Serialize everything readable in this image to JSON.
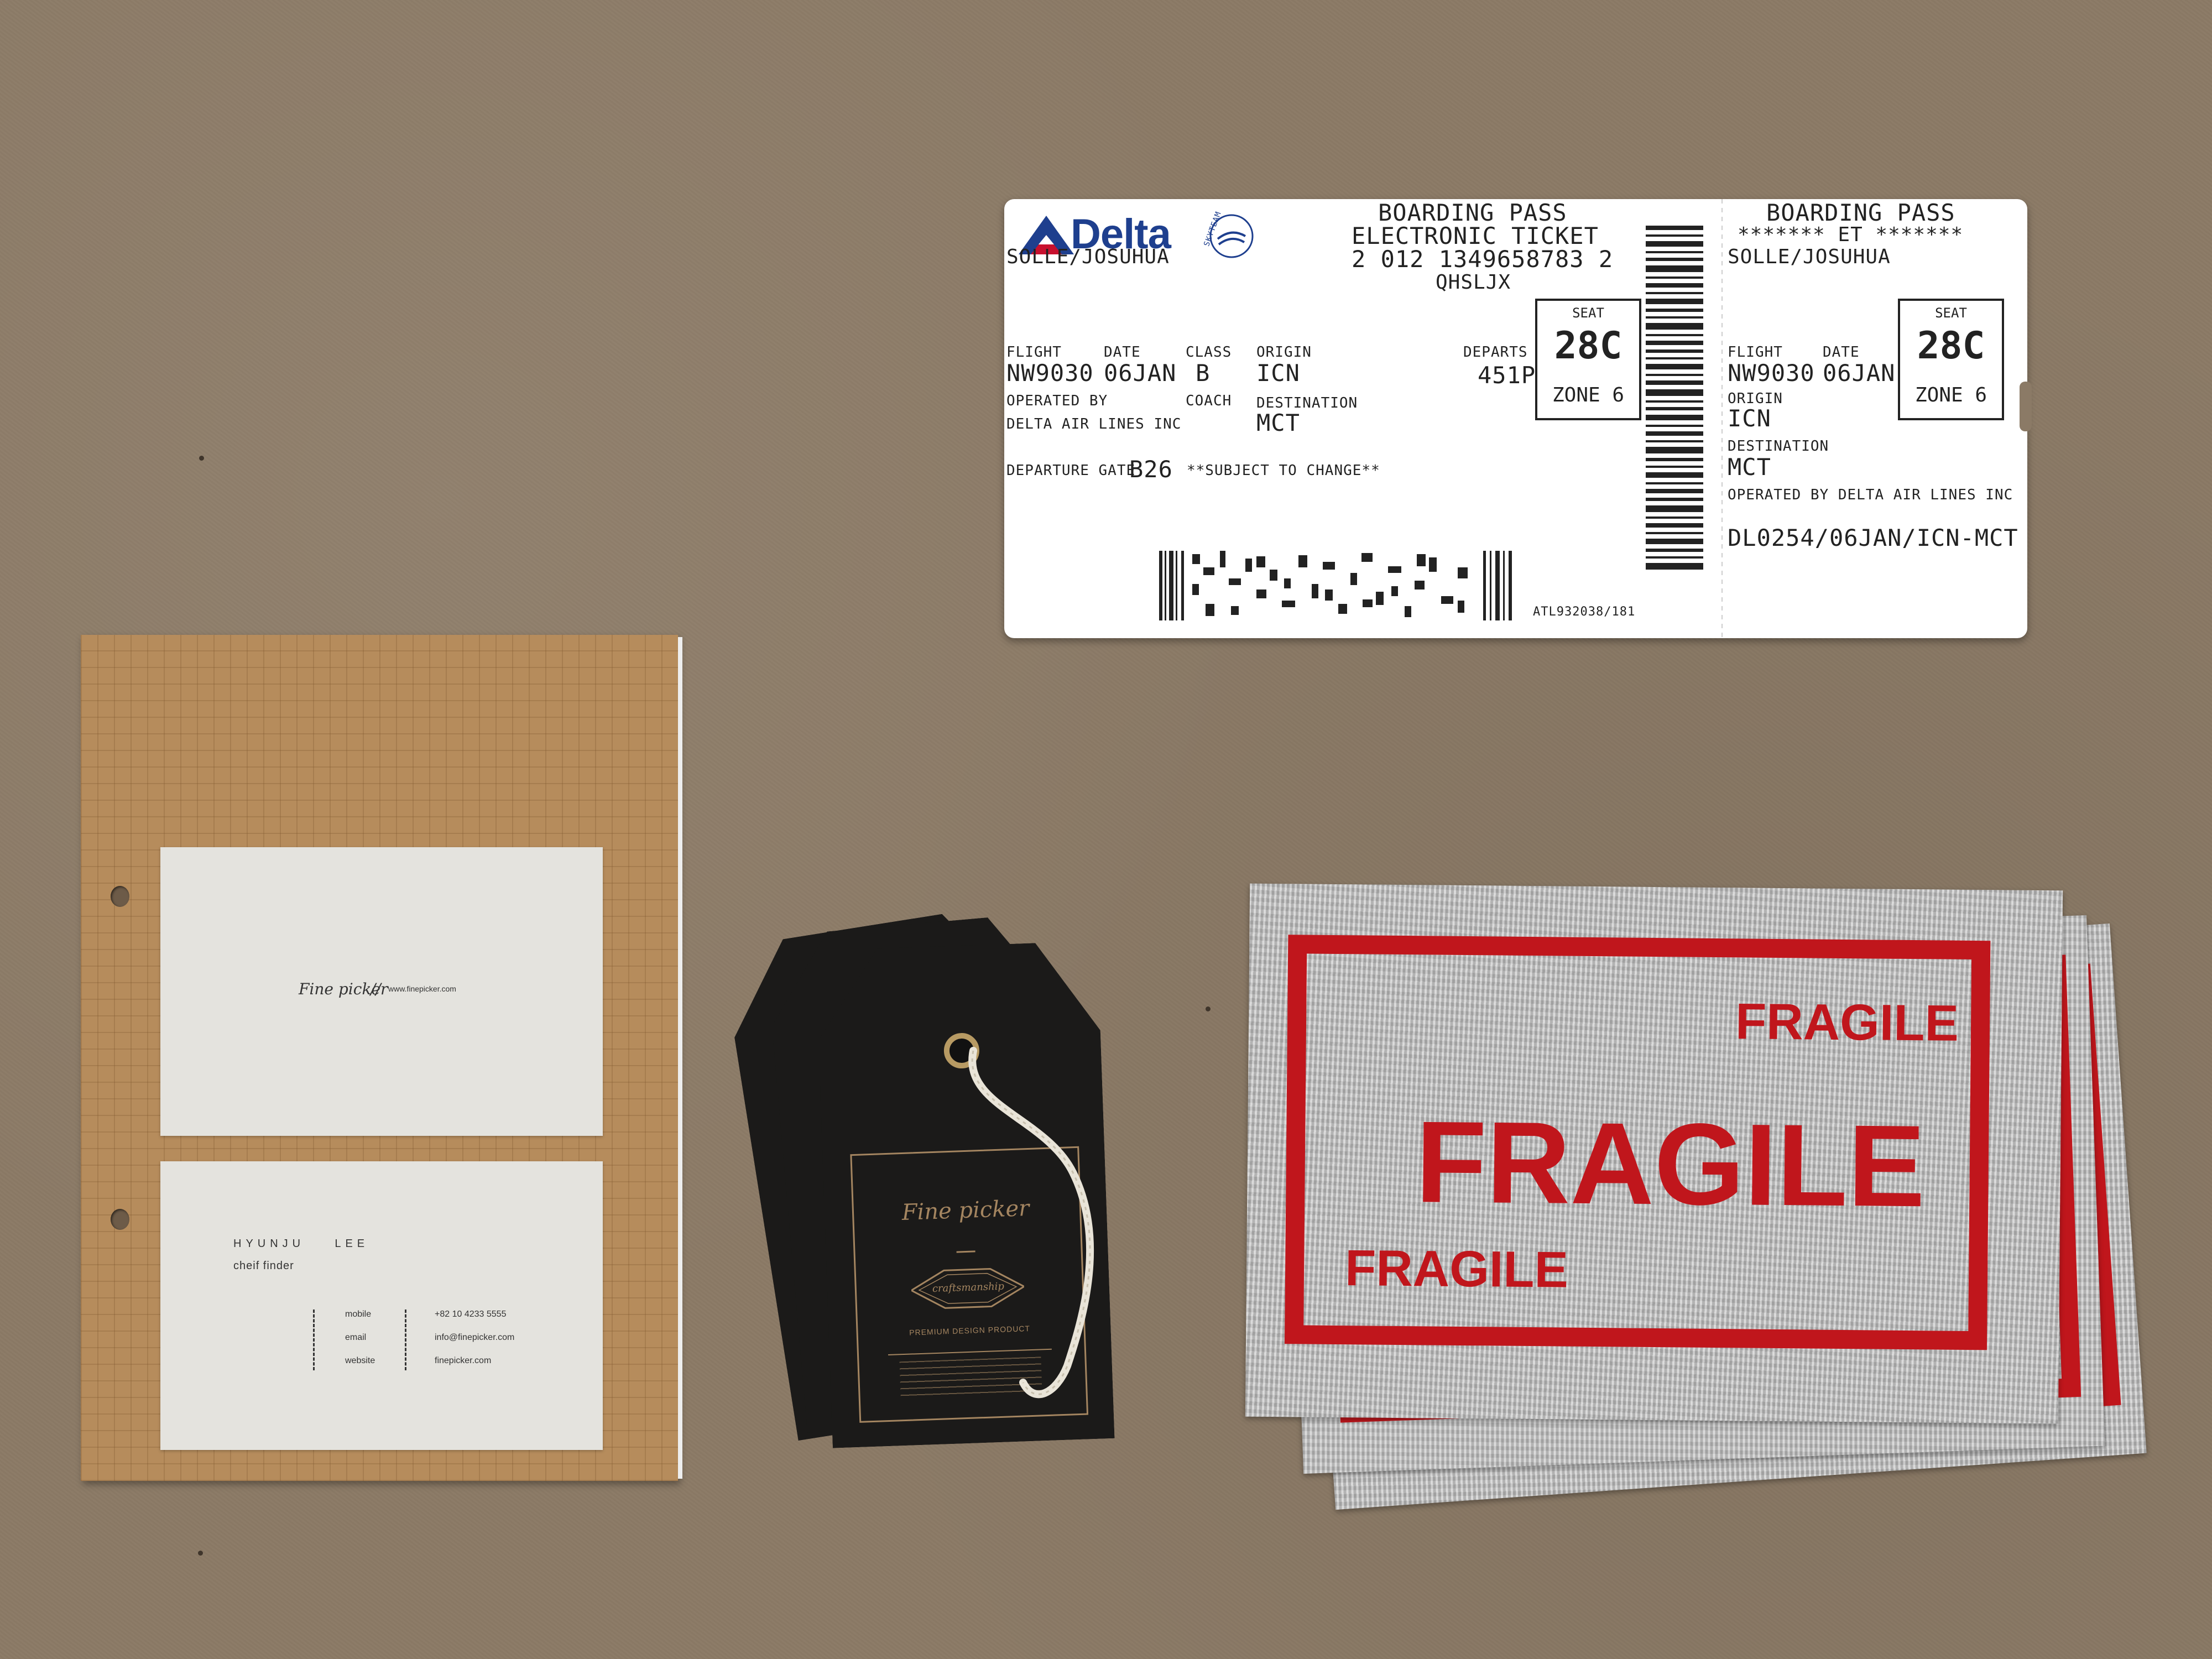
{
  "colors": {
    "background": "#8b7a66",
    "fragile_red": "#c0161c",
    "delta_blue": "#1e3f8e",
    "tag_gold": "#a48560"
  },
  "boarding_pass": {
    "logo": "Delta",
    "skyteam": "SKYTEAM",
    "heading": "BOARDING PASS",
    "electronic_ticket": "ELECTRONIC TICKET",
    "ticket_number": "2 012 1349658783 2",
    "record_locator": "QHSLJX",
    "passenger": "SOLLE/JOSUHUA",
    "flight_label": "FLIGHT",
    "flight": "NW9030",
    "date_label": "DATE",
    "date": "06JAN",
    "class_label": "CLASS",
    "class": "B",
    "coach": "COACH",
    "origin_label": "ORIGIN",
    "origin": "ICN",
    "destination_label": "DESTINATION",
    "destination": "MCT",
    "operated_by_label": "OPERATED BY",
    "operated_by": "DELTA AIR LINES INC",
    "departs_label": "DEPARTS",
    "departs": "451P",
    "seat_label": "SEAT",
    "seat": "28C",
    "zone": "ZONE 6",
    "gate_label": "DEPARTURE GATE",
    "gate": "B26",
    "subject_to_change": "**SUBJECT TO CHANGE**",
    "code": "ATL932038/181",
    "stub": {
      "heading": "BOARDING PASS",
      "et": "******* ET *******",
      "passenger": "SOLLE/JOSUHUA",
      "flight_label": "FLIGHT",
      "flight": "NW9030",
      "date_label": "DATE",
      "date": "06JAN",
      "origin_label": "ORIGIN",
      "origin": "ICN",
      "destination_label": "DESTINATION",
      "destination": "MCT",
      "operated": "OPERATED BY DELTA AIR LINES INC",
      "seat_label": "SEAT",
      "seat": "28C",
      "zone": "ZONE 6",
      "route": "DL0254/06JAN/ICN-MCT"
    }
  },
  "business_card_front": {
    "brand": "Fine picker",
    "separator": "//",
    "website": "www.finepicker.com"
  },
  "business_card_back": {
    "name": "HYUNJU    LEE",
    "title": "cheif finder",
    "contacts": [
      {
        "label": "mobile",
        "value": "+82 10 4233 5555"
      },
      {
        "label": "email",
        "value": "info@finepicker.com"
      },
      {
        "label": "website",
        "value": "finepicker.com"
      }
    ]
  },
  "hang_tag": {
    "brand": "Fine picker",
    "badge": "craftsmanship",
    "product": "PREMIUM DESIGN PRODUCT"
  },
  "fragile_labels": {
    "large": "FRAGILE",
    "top": "FRAGILE",
    "bottom": "FRAGILE"
  }
}
